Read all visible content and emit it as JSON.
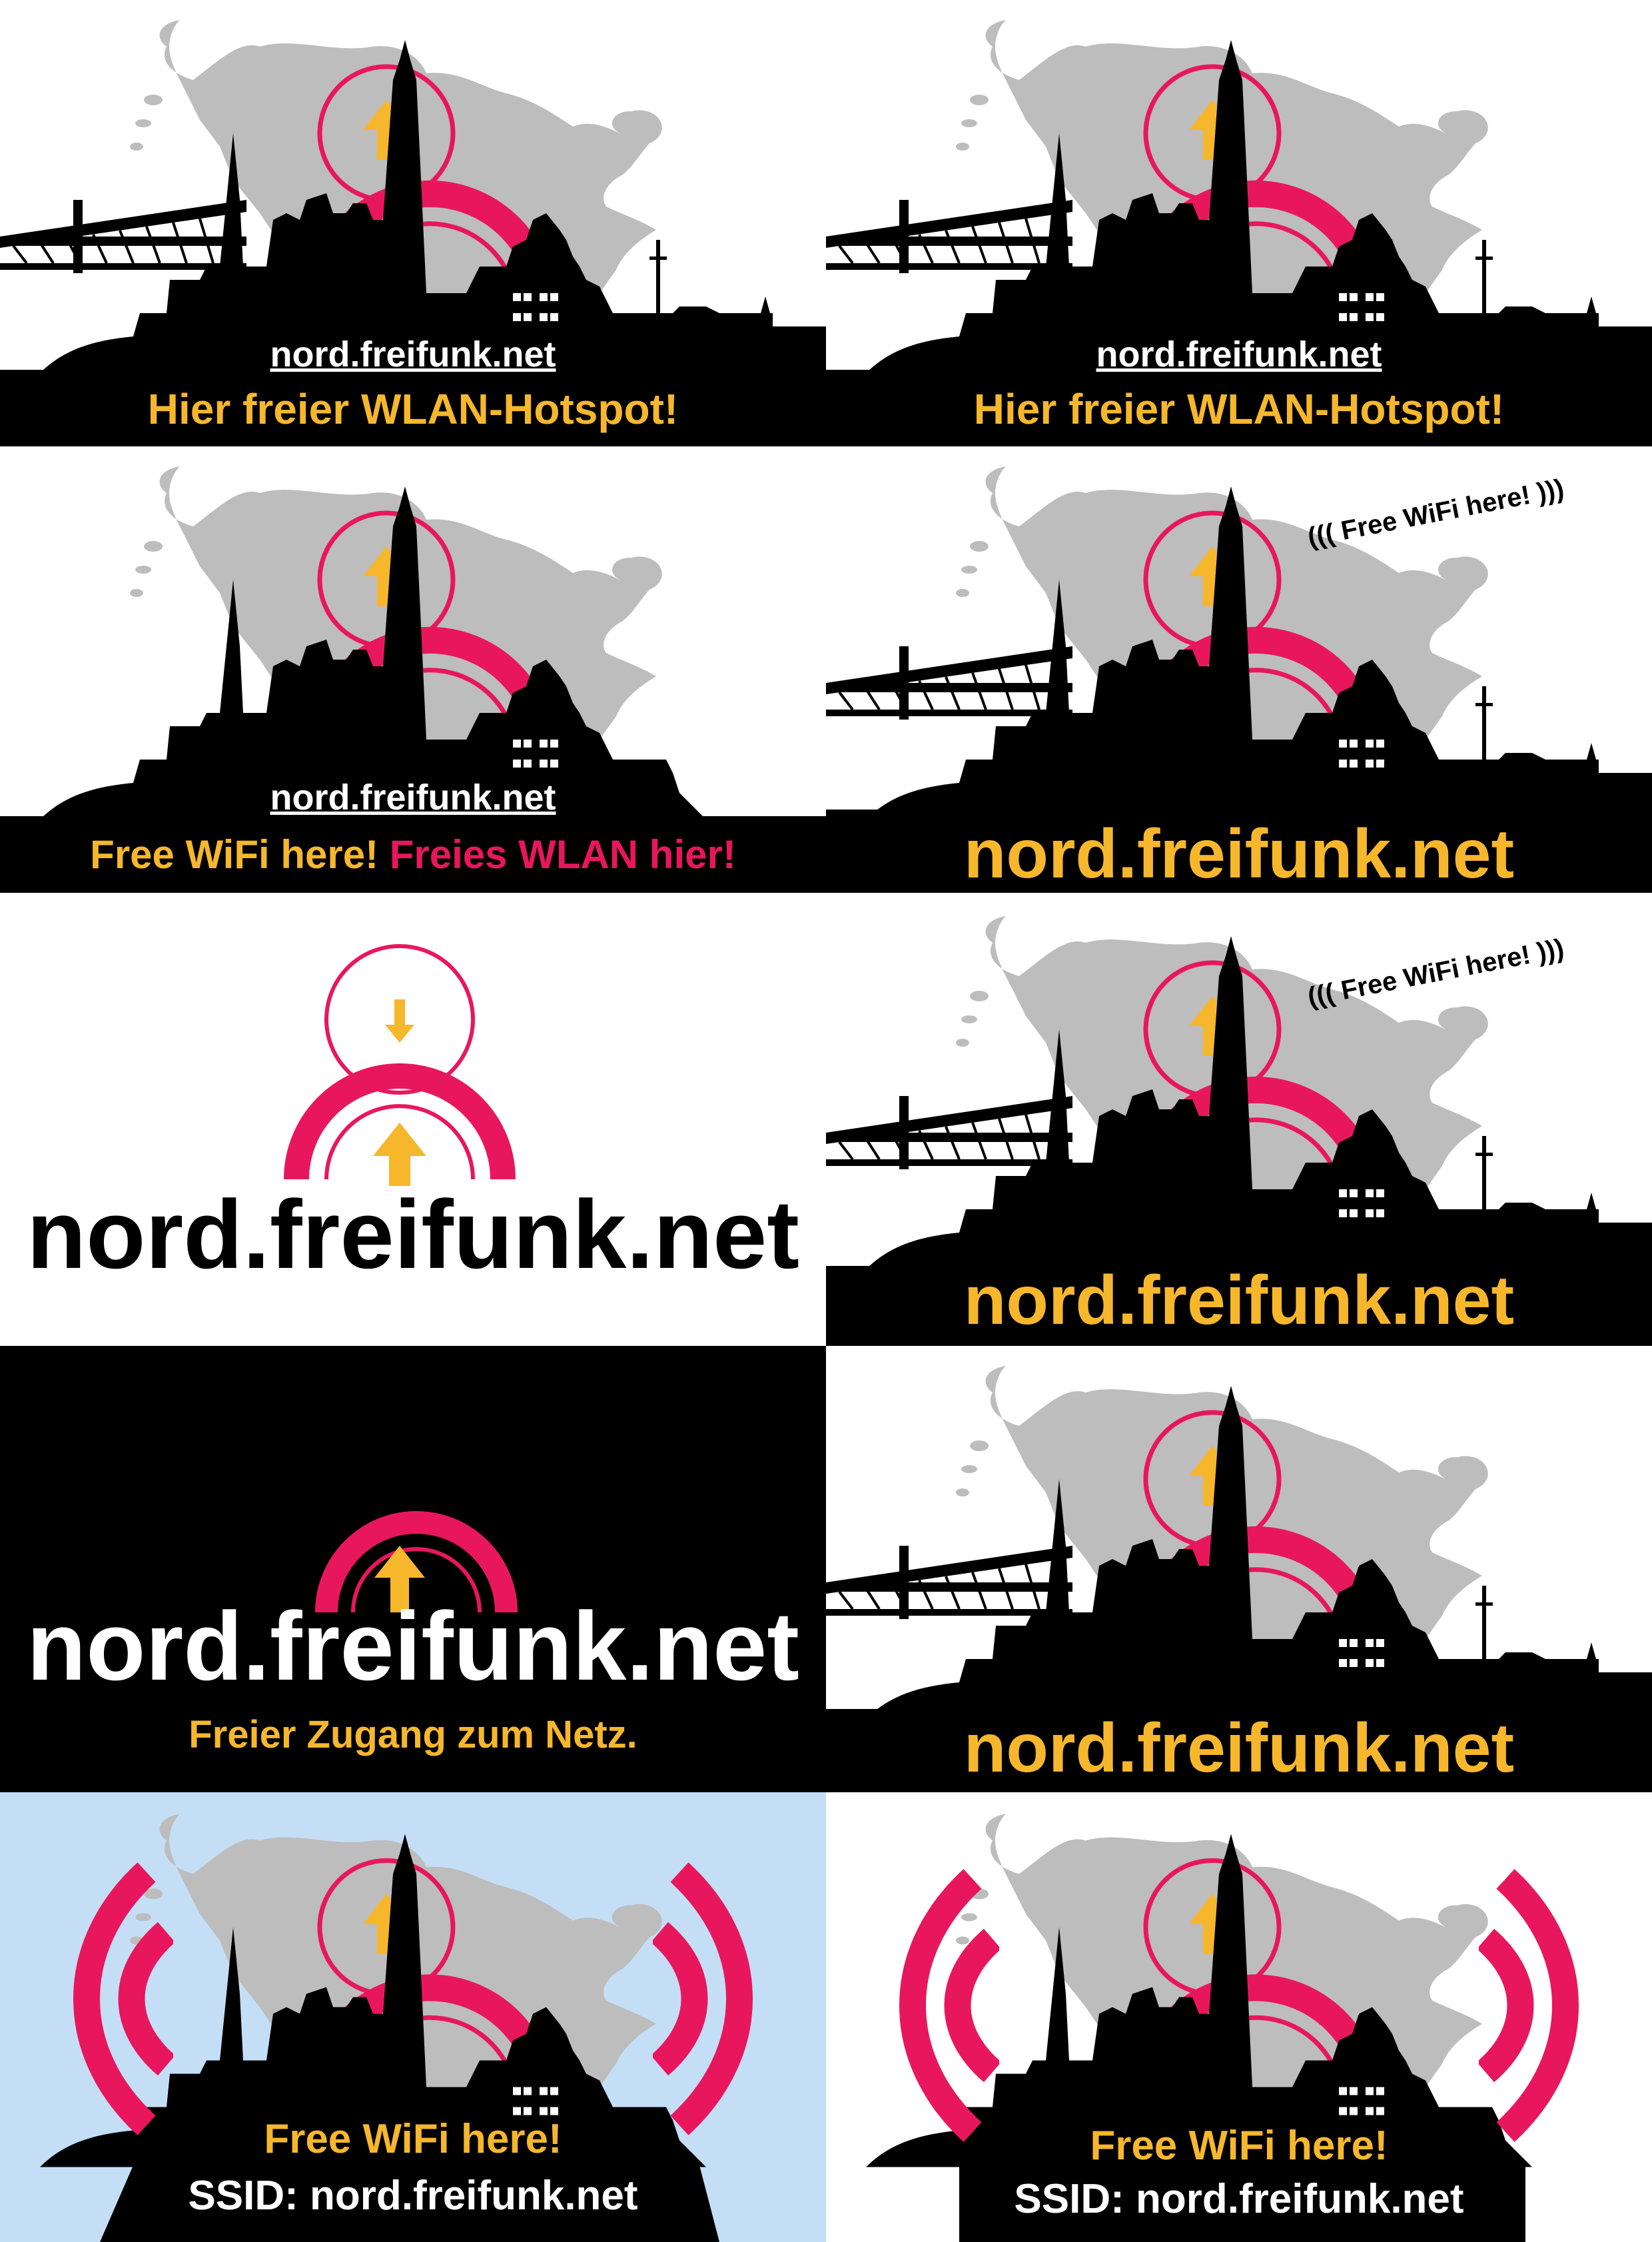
{
  "cards": {
    "c1": {
      "url": "nord.freifunk.net",
      "slogan": "Hier freier WLAN-Hotspot!"
    },
    "c2": {
      "url": "nord.freifunk.net",
      "slogan": "Hier freier WLAN-Hotspot!"
    },
    "c3": {
      "url": "nord.freifunk.net",
      "slogan_en": "Free WiFi here!",
      "slogan_de": "Freies WLAN hier!"
    },
    "c4": {
      "tag": "Free WiFi here!",
      "url": "nord.freifunk.net"
    },
    "c5": {
      "url": "nord.freifunk.net"
    },
    "c6": {
      "tag": "Free WiFi here!",
      "url": "nord.freifunk.net"
    },
    "c7": {
      "url": "nord.freifunk.net",
      "tagline": "Freier Zugang zum Netz."
    },
    "c8": {
      "url": "nord.freifunk.net"
    },
    "c9": {
      "slogan": "Free WiFi here!",
      "ssid": "SSID: nord.freifunk.net"
    },
    "c10": {
      "slogan": "Free WiFi here!",
      "ssid": "SSID: nord.freifunk.net"
    }
  },
  "colors": {
    "brand_yellow": "#f6b72c",
    "brand_pink": "#e8175d",
    "map_gray": "#bdbdbd",
    "sky_blue": "#c4def6",
    "black": "#000000",
    "white": "#ffffff"
  },
  "icons": [
    "up-arrow-icon",
    "down-arrow-icon",
    "wifi-waves-icon",
    "signal-rings-icon"
  ]
}
